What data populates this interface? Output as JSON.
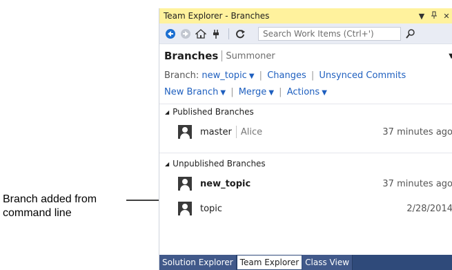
{
  "annotation": {
    "line1": "Branch added from",
    "line2": "command line"
  },
  "window": {
    "title": "Team Explorer - Branches",
    "title_icons": [
      "dropdown-icon",
      "pin-icon",
      "close-icon"
    ]
  },
  "toolbar": {
    "search_placeholder": "Search Work Items (Ctrl+')",
    "icons": [
      "back-icon",
      "forward-icon",
      "home-icon",
      "connect-icon",
      "refresh-icon",
      "search-icon"
    ]
  },
  "header": {
    "title": "Branches",
    "subtitle": "Summoner"
  },
  "links": {
    "branch_label": "Branch:",
    "current_branch": "new_topic",
    "changes": "Changes",
    "unsynced": "Unsynced Commits",
    "new_branch": "New Branch",
    "merge": "Merge",
    "actions": "Actions"
  },
  "published": {
    "title": "Published Branches",
    "branches": [
      {
        "name": "master",
        "author": "Alice",
        "time": "37 minutes ago"
      }
    ]
  },
  "unpublished": {
    "title": "Unpublished Branches",
    "branches": [
      {
        "name": "new_topic",
        "time": "37 minutes ago"
      },
      {
        "name": "topic",
        "time": "2/28/2014"
      }
    ]
  },
  "bottom_tabs": [
    "Solution Explorer",
    "Team Explorer",
    "Class View"
  ],
  "colors": {
    "titlebar": "#fff29d",
    "toolbar": "#e9ecf4",
    "link": "#1e5fbf",
    "tabbar": "#2f4a7a",
    "accent_blue": "#1c6fd1"
  }
}
